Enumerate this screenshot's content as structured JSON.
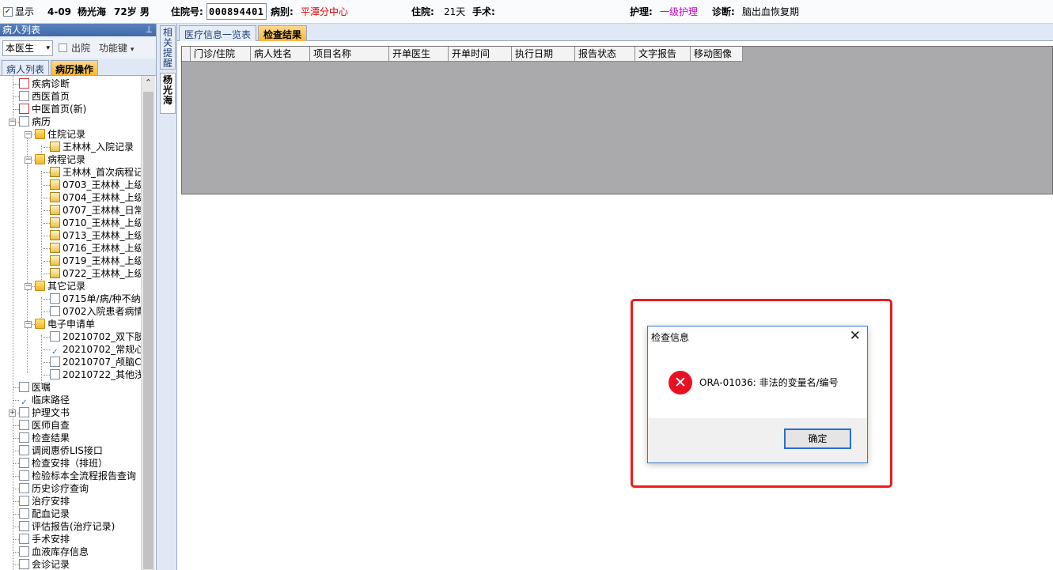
{
  "topbar": {
    "show_label": "显示",
    "bed": "4-09",
    "patient_name": "杨光海",
    "age_sex": "72岁 男",
    "admission_no_label": "住院号:",
    "admission_no": "000894401",
    "ward_label": "病别:",
    "ward": "平潭分中心",
    "stay_label": "住院:",
    "stay_days": "21天",
    "surgery_label": "手术:",
    "nursing_label": "护理:",
    "nursing_level": "一级护理",
    "diagnosis_label": "诊断:",
    "diagnosis": "脑出血恢复期"
  },
  "left_panel": {
    "title": "病人列表",
    "pin": "ᵖ",
    "doctor_select": "本医生",
    "discharged_label": "出院",
    "function_keys": "功能键",
    "tabs": [
      "病人列表",
      "病历操作"
    ],
    "tree": [
      {
        "label": "疾病诊断"
      },
      {
        "label": "西医首页"
      },
      {
        "label": "中医首页(新)"
      },
      {
        "label": "病历"
      },
      {
        "label": "住院记录"
      },
      {
        "label": "王林林_入院记录"
      },
      {
        "label": "病程记录"
      },
      {
        "label": "王林林_首次病程记"
      },
      {
        "label": "0703_王林林_上级"
      },
      {
        "label": "0704_王林林_上级"
      },
      {
        "label": "0707_王林林_日常"
      },
      {
        "label": "0710_王林林_上级"
      },
      {
        "label": "0713_王林林_上级"
      },
      {
        "label": "0716_王林林_上级"
      },
      {
        "label": "0719_王林林_上级"
      },
      {
        "label": "0722_王林林_上级"
      },
      {
        "label": "其它记录"
      },
      {
        "label": "0715单/病/种不纳"
      },
      {
        "label": "0702入院患者病情"
      },
      {
        "label": "电子申请单"
      },
      {
        "label": "20210702_双下肢静"
      },
      {
        "label": "20210702_常规心电"
      },
      {
        "label": "20210707_颅脑CT平"
      },
      {
        "label": "20210722_其他浅表"
      },
      {
        "label": "医嘱"
      },
      {
        "label": "临床路径"
      },
      {
        "label": "护理文书"
      },
      {
        "label": "医师自查"
      },
      {
        "label": "检查结果"
      },
      {
        "label": "调阅惠侨LIS接口"
      },
      {
        "label": "检查安排（排班）"
      },
      {
        "label": "检验标本全流程报告查询"
      },
      {
        "label": "历史诊疗查询"
      },
      {
        "label": "治疗安排"
      },
      {
        "label": "配血记录"
      },
      {
        "label": "评估报告(治疗记录)"
      },
      {
        "label": "手术安排"
      },
      {
        "label": "血液库存信息"
      },
      {
        "label": "会诊记录"
      }
    ]
  },
  "side_tabs": [
    "相关提醒",
    "杨光海"
  ],
  "main": {
    "tabs": [
      "医疗信息一览表",
      "检查结果"
    ],
    "columns": [
      "门诊/住院",
      "病人姓名",
      "项目名称",
      "开单医生",
      "开单时间",
      "执行日期",
      "报告状态",
      "文字报告",
      "移动图像"
    ]
  },
  "dialog": {
    "title": "检查信息",
    "close": "✕",
    "error_symbol": "✕",
    "message": "ORA-01036: 非法的变量名/编号",
    "ok_label": "确定"
  }
}
